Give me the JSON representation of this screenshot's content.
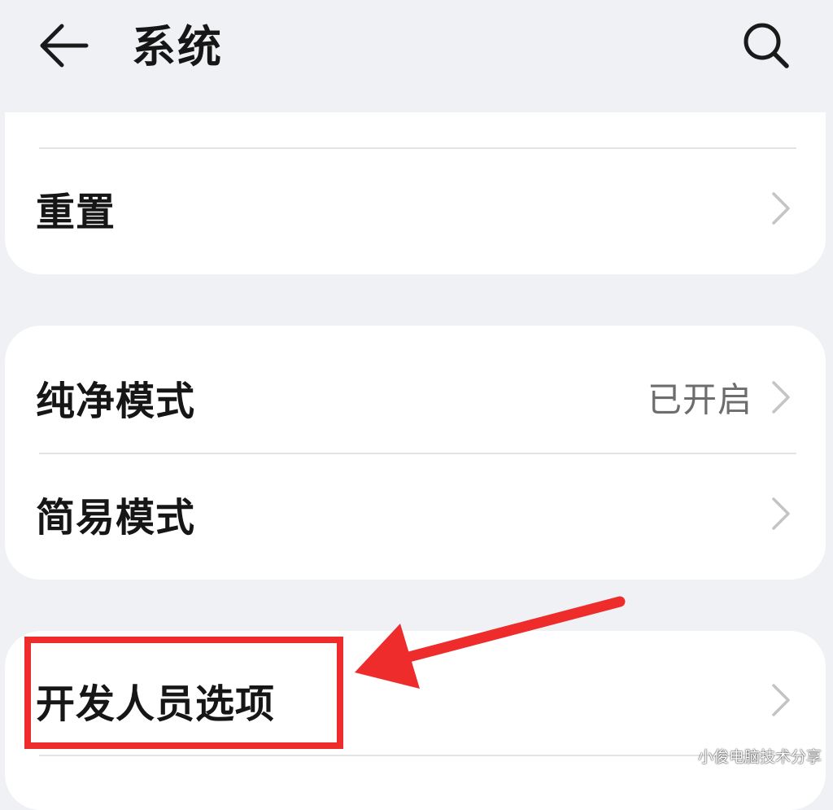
{
  "header": {
    "title": "系统"
  },
  "card1": {
    "items": [
      {
        "label": "重置",
        "value": ""
      }
    ]
  },
  "card2": {
    "items": [
      {
        "label": "纯净模式",
        "value": "已开启"
      },
      {
        "label": "简易模式",
        "value": ""
      }
    ]
  },
  "card3": {
    "items": [
      {
        "label": "开发人员选项",
        "value": ""
      }
    ]
  },
  "icons": {
    "back": "arrow-left-icon",
    "search": "search-icon",
    "chevron": "chevron-right-icon"
  },
  "colors": {
    "background": "#f0f1f5",
    "card": "#ffffff",
    "annotation": "#ee2c2c",
    "secondary_text": "#6d6d6d"
  },
  "watermark": "小俊电脑技术分享"
}
